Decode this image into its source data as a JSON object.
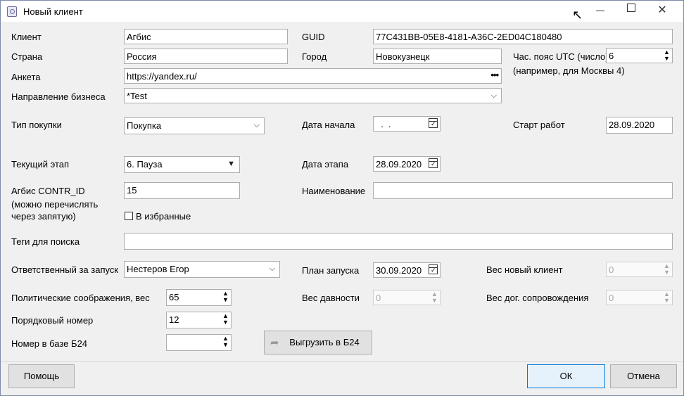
{
  "window": {
    "title": "Новый клиент"
  },
  "client": {
    "label": "Клиент",
    "value": "Агбис"
  },
  "guid": {
    "label": "GUID",
    "value": "77C431BB-05E8-4181-A36C-2ED04C180480"
  },
  "country": {
    "label": "Страна",
    "value": "Россия"
  },
  "city": {
    "label": "Город",
    "value": "Новокузнецк"
  },
  "timezone": {
    "label": "Час. пояс UTC (число)",
    "hint": "(например, для Москвы 4)",
    "value": "6"
  },
  "survey": {
    "label": "Анкета",
    "value": "https://yandex.ru/",
    "button": "•••"
  },
  "business": {
    "label": "Направление бизнеса",
    "value": "*Test"
  },
  "purchase_type": {
    "label": "Тип покупки",
    "value": "Покупка"
  },
  "start_date": {
    "label": "Дата начала",
    "value": "  .  ."
  },
  "work_start": {
    "label": "Старт работ",
    "value": "28.09.2020"
  },
  "current_stage": {
    "label": "Текущий этап",
    "value": "6. Пауза"
  },
  "stage_date": {
    "label": "Дата этапа",
    "value": "28.09.2020"
  },
  "contr_id": {
    "label1": "Агбис CONTR_ID",
    "label2": "(можно перечислять",
    "label3": "через запятую)",
    "value": "15"
  },
  "name": {
    "label": "Наименование",
    "value": ""
  },
  "favorite": {
    "label": "В избранные"
  },
  "tags": {
    "label": "Теги для поиска",
    "value": ""
  },
  "responsible": {
    "label": "Ответственный за запуск",
    "value": "Нестеров Егор"
  },
  "launch_plan": {
    "label": "План запуска",
    "value": "30.09.2020"
  },
  "weight_new": {
    "label": "Вес новый клиент",
    "value": "0"
  },
  "political": {
    "label": "Политические соображения, вес",
    "value": "65"
  },
  "weight_age": {
    "label": "Вес давности",
    "value": "0"
  },
  "weight_contract": {
    "label": "Вес дог. сопровождения",
    "value": "0"
  },
  "ordinal": {
    "label": "Порядковый номер",
    "value": "12"
  },
  "b24_number": {
    "label": "Номер в базе Б24",
    "value": ""
  },
  "buttons": {
    "export": "Выгрузить в Б24",
    "help": "Помощь",
    "ok": "ОК",
    "cancel": "Отмена"
  }
}
